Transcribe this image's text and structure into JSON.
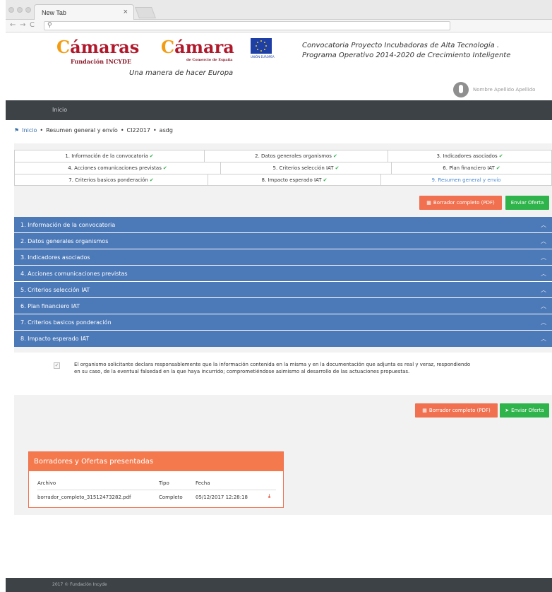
{
  "browser": {
    "tab_title": "New Tab",
    "tab_close": "×",
    "url": "",
    "back_icon": "arrow-left-icon",
    "forward_icon": "arrow-right-icon",
    "reload_icon": "reload-icon",
    "search_icon": "search-icon"
  },
  "header": {
    "logo1_first": "C",
    "logo1_rest": "ámaras",
    "logo1_sub": "Fundación INCYDE",
    "logo2_first": "C",
    "logo2_rest": "ámara",
    "logo2_sub": "de Comercio de España",
    "tagline": "Una manera de hacer Europa",
    "eu_label": "UNIÓN EUROPEA",
    "convocatoria_line1": "Convocatoria Proyecto Incubadoras de Alta Tecnología .",
    "convocatoria_line2": "Programa Operativo 2014-2020 de Crecimiento Inteligente",
    "user_name": "Nombre Apellido Apellido"
  },
  "nav": {
    "inicio": "Inicio"
  },
  "breadcrumb": {
    "home": "Inicio",
    "sep": "•",
    "item1": "Resumen general y envío",
    "item2": "CI22017",
    "item3": "asdg"
  },
  "steps": {
    "row1": [
      "1. Información de la convocatoria",
      "2. Datos generales organismos",
      "3. Indicadores asociados"
    ],
    "row2": [
      "4. Acciones comunicaciones previstas",
      "5. Criterios selección IAT",
      "6. Plan financiero IAT"
    ],
    "row3": [
      "7. Criterios basicos ponderación",
      "8. Impacto esperado IAT",
      "9. Resumen general y envío"
    ],
    "check": "✔"
  },
  "buttons": {
    "borrador": "Borrador completo (PDF)",
    "enviar": "Enviar Oferta",
    "enviar2": "Enviar Oferta"
  },
  "accordion": [
    "1. Información de la convocatoria",
    "2. Datos generales organismos",
    "3. Indicadores asociados",
    "4. Acciones comunicaciones previstas",
    "5. Criterios selección IAT",
    "6. Plan financiero IAT",
    "7. Criterios basicos ponderación",
    "8. Impacto esperado IAT"
  ],
  "declaration": {
    "checked": "✓",
    "text": "El organismo solicitante declara responsablemente que la información contenida en la misma y en la documentación que adjunta es real y veraz, respondiendo en su caso, de la eventual falsedad en la que haya incurrido; comprometiéndose asimismo al desarrollo de las actuaciones propuestas."
  },
  "panel": {
    "title": "Borradores y Ofertas presentadas",
    "columns": [
      "Archivo",
      "Tipo",
      "Fecha"
    ],
    "rows": [
      {
        "archivo": "borrador_completo_31512473282.pdf",
        "tipo": "Completo",
        "fecha": "05/12/2017 12:28:18",
        "icon": "download-icon"
      }
    ]
  },
  "footer": {
    "text": "2017 © Fundación Incyde"
  },
  "colors": {
    "nav_bg": "#3d4247",
    "accordion": "#4c79b8",
    "orange": "#f0704f",
    "green": "#2fb34b",
    "check": "#2db34a"
  }
}
